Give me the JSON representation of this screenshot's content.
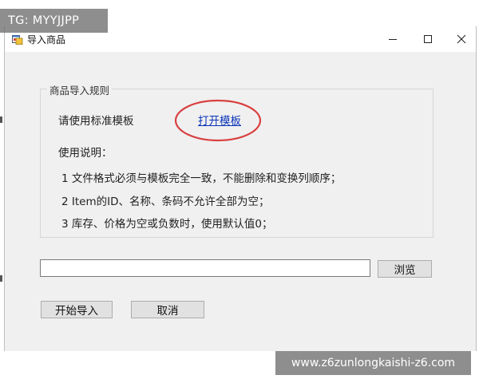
{
  "watermark_top": "TG: MYYJJPP",
  "watermark_bottom": "www.z6zunlongkaishi-z6.com",
  "window": {
    "title": "导入商品",
    "icon": "app-window-icon"
  },
  "titlebar_buttons": {
    "minimize_icon": "minimize-icon",
    "maximize_icon": "maximize-icon",
    "close_icon": "close-icon"
  },
  "rules_group": {
    "legend": "商品导入规则",
    "template_prompt": "请使用标准模板",
    "open_template_link": "打开模板",
    "usage_title": "使用说明：",
    "rules": [
      "1  文件格式必须与模板完全一致，不能删除和变换列顺序；",
      "2  Item的ID、名称、条码不允许全部为空；",
      "3  库存、价格为空或负数时，使用默认值0；"
    ]
  },
  "file_path": {
    "value": "",
    "placeholder": ""
  },
  "buttons": {
    "browse": "浏览",
    "start_import": "开始导入",
    "cancel": "取消"
  },
  "colors": {
    "annotation_circle": "#d94040",
    "link": "#0a35b8"
  }
}
